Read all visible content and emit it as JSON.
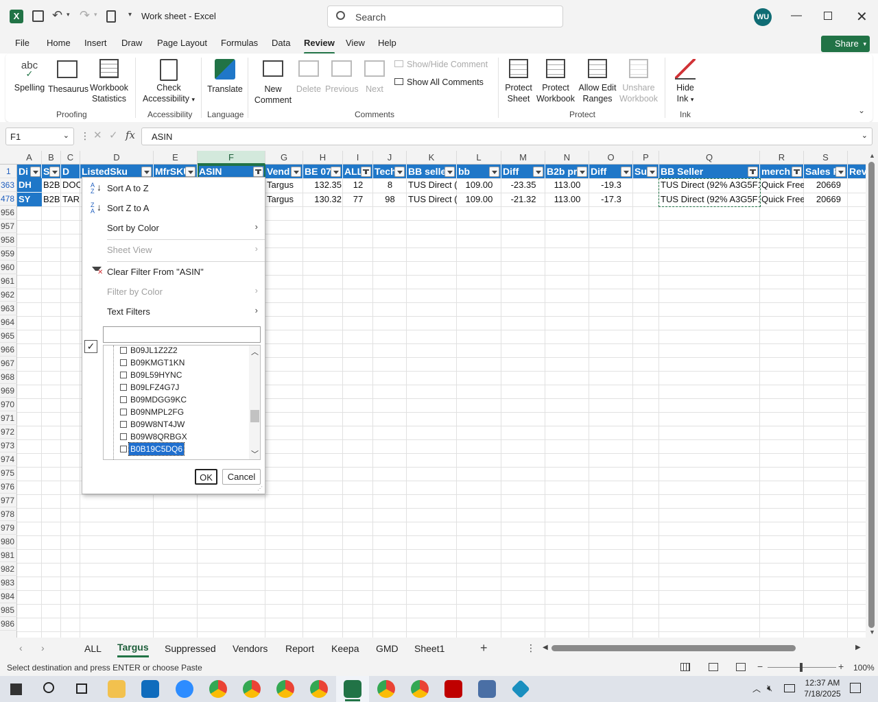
{
  "app": {
    "title": "Work sheet  -  Excel",
    "search_placeholder": "Search",
    "user_initials": "WU"
  },
  "ribbon_tabs": [
    "File",
    "Home",
    "Insert",
    "Draw",
    "Page Layout",
    "Formulas",
    "Data",
    "Review",
    "View",
    "Help"
  ],
  "active_tab": "Review",
  "share_label": "Share",
  "ribbon": {
    "proofing": {
      "group": "Proofing",
      "spelling": "Spelling",
      "thesaurus": "Thesaurus",
      "stats1": "Workbook",
      "stats2": "Statistics"
    },
    "accessibility": {
      "group": "Accessibility",
      "l1": "Check",
      "l2": "Accessibility"
    },
    "language": {
      "group": "Language",
      "translate": "Translate"
    },
    "comments": {
      "group": "Comments",
      "new1": "New",
      "new2": "Comment",
      "delete": "Delete",
      "previous": "Previous",
      "next": "Next",
      "show_hide": "Show/Hide Comment",
      "show_all": "Show All Comments"
    },
    "protect": {
      "group": "Protect",
      "ps1": "Protect",
      "ps2": "Sheet",
      "pw1": "Protect",
      "pw2": "Workbook",
      "ae1": "Allow Edit",
      "ae2": "Ranges",
      "uw1": "Unshare",
      "uw2": "Workbook"
    },
    "ink": {
      "group": "Ink",
      "h1": "Hide",
      "h2": "Ink"
    }
  },
  "name_box": "F1",
  "formula": "ASIN",
  "columns": [
    "A",
    "B",
    "C",
    "D",
    "E",
    "F",
    "G",
    "H",
    "I",
    "J",
    "K",
    "L",
    "M",
    "N",
    "O",
    "P",
    "Q",
    "R",
    "S"
  ],
  "header_row": [
    "Di",
    "S",
    "D",
    "ListedSku",
    "MfrSKU",
    "ASIN",
    "Vend",
    "BE 07",
    "ALL",
    "Tech",
    "BB selle",
    "bb",
    "Diff",
    "B2b pr",
    "Diff",
    "Su",
    "BB Seller",
    "merch",
    "Sales R",
    "Rev"
  ],
  "rows": [
    {
      "num": "363",
      "cells": [
        "DH",
        "B2B",
        "DOC",
        "",
        "",
        "",
        "Targus",
        "132.35",
        "12",
        "8",
        "TUS Direct (",
        "109.00",
        "-23.35",
        "113.00",
        "-19.3",
        "",
        "TUS Direct (92% A3G5F1",
        "Quick Free",
        "20669"
      ]
    },
    {
      "num": "478",
      "cells": [
        "SY",
        "B2B",
        "TAR",
        "",
        "",
        "",
        "Targus",
        "130.32",
        "77",
        "98",
        "TUS Direct (",
        "109.00",
        "-21.32",
        "113.00",
        "-17.3",
        "",
        "TUS Direct (92% A3G5F1",
        "Quick Free",
        "20669"
      ]
    }
  ],
  "empty_rows": [
    "956",
    "957",
    "958",
    "959",
    "960",
    "961",
    "962",
    "963",
    "964",
    "965",
    "966",
    "967",
    "968",
    "969",
    "970",
    "971",
    "972",
    "973",
    "974",
    "975",
    "976",
    "977",
    "978",
    "979",
    "980",
    "981",
    "982",
    "983",
    "984",
    "985",
    "986"
  ],
  "filter_menu": {
    "sort_az": "Sort A to Z",
    "sort_za": "Sort Z to A",
    "sort_color": "Sort by Color",
    "sheet_view": "Sheet View",
    "clear": "Clear Filter From \"ASIN\"",
    "filter_color": "Filter by Color",
    "text_filters": "Text Filters",
    "items": [
      "B09JL1Z2Z2",
      "B09KMGT1KN",
      "B09L59HYNC",
      "B09LFZ4G7J",
      "B09MDGG9KC",
      "B09NMPL2FG",
      "B09W8NT4JW",
      "B09W8QRBGX",
      "B0B19C5DQ6"
    ],
    "ok": "OK",
    "cancel": "Cancel"
  },
  "sheet_tabs": [
    "ALL",
    "Targus",
    "Suppressed",
    "Vendors",
    "Report",
    "Keepa",
    "GMD",
    "Sheet1"
  ],
  "active_sheet": "Targus",
  "status_text": "Select destination and press ENTER or choose Paste",
  "zoom": "100%",
  "clock": {
    "time": "12:37 AM",
    "date": "7/18/2025"
  },
  "colors": {
    "excel_green": "#217346",
    "header_blue": "#1f77c8"
  }
}
